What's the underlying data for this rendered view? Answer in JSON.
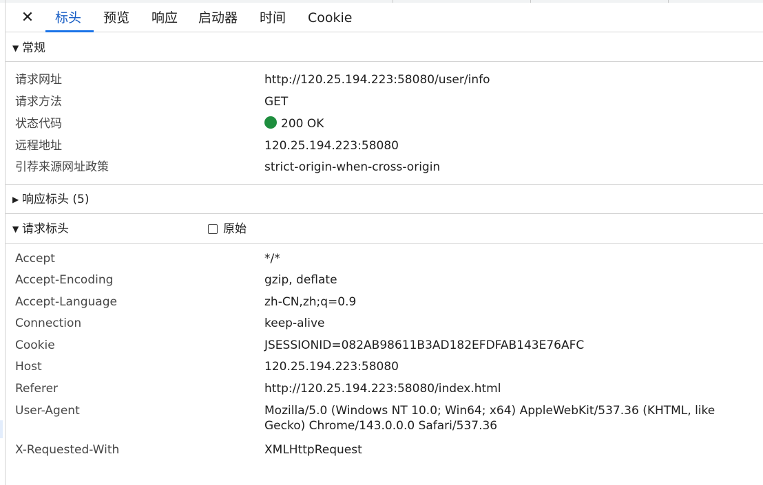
{
  "tabs": {
    "close_glyph": "✕",
    "items": [
      "标头",
      "预览",
      "响应",
      "启动器",
      "时间",
      "Cookie"
    ],
    "active_index": 0
  },
  "general": {
    "title": "常规",
    "expanded": true,
    "rows": [
      {
        "name": "请求网址",
        "value": "http://120.25.194.223:58080/user/info"
      },
      {
        "name": "请求方法",
        "value": "GET"
      },
      {
        "name": "状态代码",
        "value": "200 OK",
        "status_color": "#1e8e3e"
      },
      {
        "name": "远程地址",
        "value": "120.25.194.223:58080"
      },
      {
        "name": "引荐来源网址政策",
        "value": "strict-origin-when-cross-origin"
      }
    ]
  },
  "response_headers": {
    "title": "响应标头 (5)",
    "expanded": false
  },
  "request_headers": {
    "title": "请求标头",
    "expanded": true,
    "raw_label": "原始",
    "raw_checked": false,
    "rows": [
      {
        "name": "Accept",
        "value": "*/*"
      },
      {
        "name": "Accept-Encoding",
        "value": "gzip, deflate"
      },
      {
        "name": "Accept-Language",
        "value": "zh-CN,zh;q=0.9"
      },
      {
        "name": "Connection",
        "value": "keep-alive"
      },
      {
        "name": "Cookie",
        "value": "JSESSIONID=082AB98611B3AD182EFDFAB143E76AFC"
      },
      {
        "name": "Host",
        "value": "120.25.194.223:58080"
      },
      {
        "name": "Referer",
        "value": "http://120.25.194.223:58080/index.html"
      },
      {
        "name": "User-Agent",
        "value": "Mozilla/5.0 (Windows NT 10.0; Win64; x64) AppleWebKit/537.36 (KHTML, like Gecko) Chrome/143.0.0.0 Safari/537.36"
      },
      {
        "name": "X-Requested-With",
        "value": "XMLHttpRequest"
      }
    ]
  },
  "colors": {
    "accent": "#1a73e8",
    "status_ok": "#1e8e3e"
  }
}
